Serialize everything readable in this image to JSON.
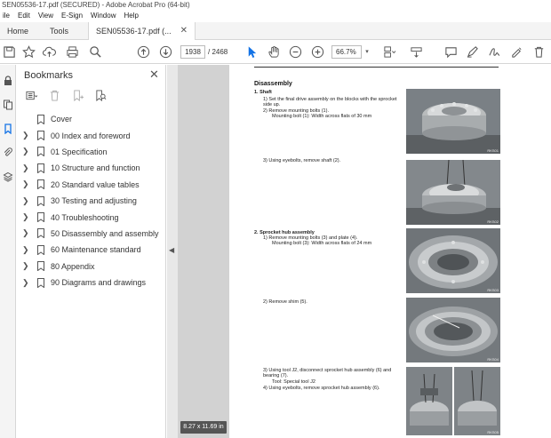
{
  "window": {
    "title": "SEN05536-17.pdf (SECURED) - Adobe Acrobat Pro (64-bit)"
  },
  "menu": [
    "ile",
    "Edit",
    "View",
    "E-Sign",
    "Window",
    "Help"
  ],
  "tabs": {
    "home": "Home",
    "tools": "Tools",
    "document": "SEN05536-17.pdf (..."
  },
  "toolbar": {
    "current_page": "1938",
    "page_total": "/ 2468",
    "zoom": "66.7%"
  },
  "bookmarks": {
    "title": "Bookmarks",
    "items": [
      {
        "label": "Cover",
        "has_children": false
      },
      {
        "label": "00 Index and foreword",
        "has_children": true
      },
      {
        "label": "01 Specification",
        "has_children": true
      },
      {
        "label": "10 Structure and function",
        "has_children": true
      },
      {
        "label": "20 Standard value tables",
        "has_children": true
      },
      {
        "label": "30 Testing and adjusting",
        "has_children": true
      },
      {
        "label": "40 Troubleshooting",
        "has_children": true
      },
      {
        "label": "50 Disassembly and assembly",
        "has_children": true
      },
      {
        "label": "60 Maintenance standard",
        "has_children": true
      },
      {
        "label": "80 Appendix",
        "has_children": true
      },
      {
        "label": "90 Diagrams and drawings",
        "has_children": true
      }
    ]
  },
  "page_size": "8.27 x 11.69 in",
  "document": {
    "section": "Disassembly",
    "shaft_heading": "1.   Shaft",
    "shaft_step1": "1)  Set the final drive assembly on the blocks with the sprocket side up.",
    "shaft_step2": "2)  Remove mounting bolts (1).",
    "shaft_step2_note": "Mounting bolt (1): Width across flats of 30 mm",
    "shaft_step3": "3)  Using eyebolts, remove shaft (2).",
    "hub_heading": "2.   Sprocket hub assembly",
    "hub_step1": "1)  Remove mounting bolts (3) and plate (4).",
    "hub_step1_note": "Mounting bolt (3): Width across flats of 24 mm",
    "hub_step2": "2)  Remove shim (5).",
    "hub_step3": "3)  Using tool J2, disconnect sprocket hub assembly (6) and bearing (7).",
    "hub_step3_note": "Tool: Special tool J2",
    "hub_step4": "4)  Using eyebolts, remove sprocket hub assembly (6).",
    "photo_labels": [
      "RKS01",
      "RKS02",
      "RKS03",
      "RKS04",
      "RKS05"
    ]
  },
  "colors": {
    "accent": "#1473e6",
    "doc_background": "#d2d2d2"
  }
}
